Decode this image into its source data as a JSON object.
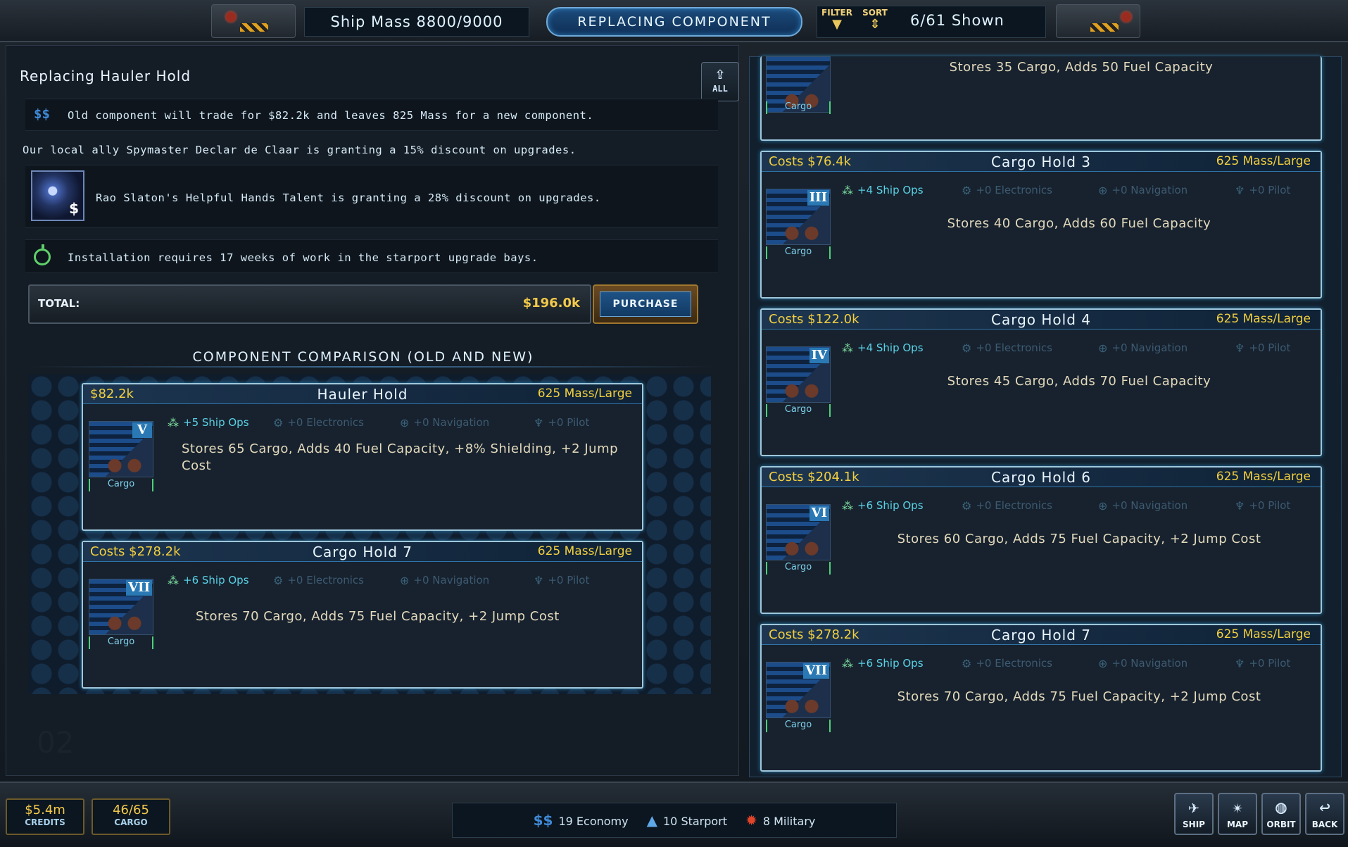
{
  "topbar": {
    "ship_mass": "Ship Mass 8800/9000",
    "mode": "REPLACING COMPONENT",
    "filter_label": "FILTER",
    "sort_label": "SORT",
    "shown": "6/61 Shown",
    "filter_icon": "funnel-icon",
    "sort_icon": "up-down-chevron-icon"
  },
  "left": {
    "title": "Replacing Hauler Hold",
    "upload_label": "ALL",
    "trade_icon": "$$",
    "trade_text": "Old component will trade for $82.2k and leaves 825 Mass for a new component.",
    "ally_text": "Our local ally Spymaster Declar de Claar is granting a 15% discount on upgrades.",
    "talent_icon_symbol": "$",
    "talent_text": "Rao Slaton's Helpful Hands Talent is granting a 28% discount on upgrades.",
    "install_text": "Installation requires 17 weeks of work in the starport upgrade bays.",
    "total_label": "TOTAL:",
    "total_value": "$196.0k",
    "purchase_label": "PURCHASE",
    "comparison_title": "COMPONENT COMPARISON (OLD AND NEW)",
    "watermark": "02"
  },
  "stat_labels": {
    "electronics": "+0 Electronics",
    "navigation": "+0 Navigation",
    "pilot": "+0 Pilot"
  },
  "old_card": {
    "price": "$82.2k",
    "name": "Hauler Hold",
    "mass": "625 Mass/Large",
    "ship_ops": "+5 Ship Ops",
    "tier": "V",
    "category": "Cargo",
    "desc": "Stores 65 Cargo, Adds 40 Fuel Capacity, +8% Shielding, +2 Jump Cost"
  },
  "new_card": {
    "price": "Costs $278.2k",
    "name": "Cargo Hold 7",
    "mass": "625 Mass/Large",
    "ship_ops": "+6 Ship Ops",
    "tier": "VII",
    "category": "Cargo",
    "desc": "Stores 70 Cargo, Adds 75 Fuel Capacity, +2 Jump Cost"
  },
  "list": {
    "partial": {
      "category": "Cargo",
      "desc": "Stores 35 Cargo, Adds 50 Fuel Capacity"
    },
    "items": [
      {
        "price": "Costs $76.4k",
        "name": "Cargo Hold 3",
        "mass": "625 Mass/Large",
        "ship_ops": "+4 Ship Ops",
        "tier": "III",
        "category": "Cargo",
        "desc": "Stores 40 Cargo, Adds 60 Fuel Capacity"
      },
      {
        "price": "Costs $122.0k",
        "name": "Cargo Hold 4",
        "mass": "625 Mass/Large",
        "ship_ops": "+4 Ship Ops",
        "tier": "IV",
        "category": "Cargo",
        "desc": "Stores 45 Cargo, Adds 70 Fuel Capacity"
      },
      {
        "price": "Costs $204.1k",
        "name": "Cargo Hold 6",
        "mass": "625 Mass/Large",
        "ship_ops": "+6 Ship Ops",
        "tier": "VI",
        "category": "Cargo",
        "desc": "Stores 60 Cargo, Adds 75 Fuel Capacity, +2 Jump Cost"
      },
      {
        "price": "Costs $278.2k",
        "name": "Cargo Hold 7",
        "mass": "625 Mass/Large",
        "ship_ops": "+6 Ship Ops",
        "tier": "VII",
        "category": "Cargo",
        "desc": "Stores 70 Cargo, Adds 75 Fuel Capacity, +2 Jump Cost"
      }
    ]
  },
  "bottombar": {
    "credits_value": "$5.4m",
    "credits_label": "CREDITS",
    "cargo_value": "46/65",
    "cargo_label": "CARGO",
    "economy_icon": "$$",
    "economy": "19 Economy",
    "starport": "10 Starport",
    "military": "8 Military",
    "nav": {
      "ship": "SHIP",
      "map": "MAP",
      "orbit": "ORBIT",
      "back": "BACK"
    }
  },
  "colors": {
    "gold": "#f2cf3e",
    "cyan": "#5bd2e6",
    "card_border": "#9fc7db",
    "accent_blue": "#2a79b4"
  }
}
